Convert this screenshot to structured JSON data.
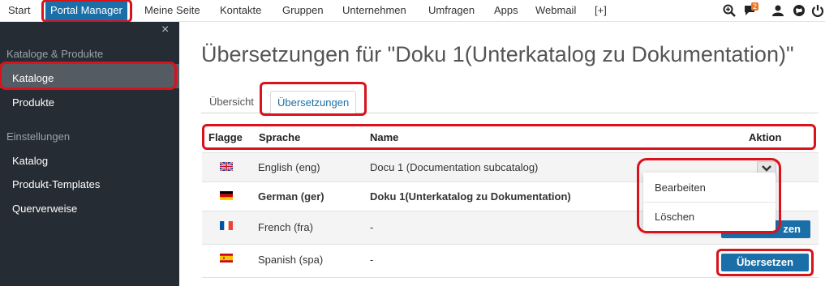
{
  "topnav": {
    "items": [
      "Start",
      "Portal Manager",
      "Meine Seite",
      "Kontakte",
      "Gruppen",
      "Unternehmen",
      "Umfragen",
      "Apps",
      "Webmail",
      "[+]"
    ],
    "notification_count": "2",
    "icons": [
      "zoom-icon",
      "chat-icon",
      "user-icon",
      "globe-icon",
      "power-icon"
    ]
  },
  "sidebar": {
    "close": "×",
    "sections": [
      "Kataloge & Produkte",
      "Einstellungen"
    ],
    "items": [
      "Kataloge",
      "Produkte",
      "Katalog",
      "Produkt-Templates",
      "Querverweise"
    ]
  },
  "main": {
    "title": "Übersetzungen für \"Doku 1(Unterkatalog zu Dokumentation)\"",
    "tabs": [
      "Übersicht",
      "Übersetzungen"
    ],
    "table": {
      "headers": [
        "Flagge",
        "Sprache",
        "Name",
        "Aktion"
      ],
      "rows": [
        {
          "language": "English (eng)",
          "name": "Docu 1 (Documentation subcatalog)",
          "flag": "gb-flag-icon"
        },
        {
          "language": "German (ger)",
          "name": "Doku 1(Unterkatalog zu Dokumentation)",
          "flag": "de-flag-icon"
        },
        {
          "language": "French (fra)",
          "name": "-",
          "flag": "fr-flag-icon"
        },
        {
          "language": "Spanish (spa)",
          "name": "-",
          "flag": "es-flag-icon"
        }
      ],
      "translate_label": "Übersetzen",
      "french_translate_visible": "zen"
    },
    "dropdown": {
      "items": [
        "Bearbeiten",
        "Löschen"
      ]
    }
  },
  "colors": {
    "accent": "#1b6fa8",
    "highlight": "#d9121c",
    "sidebar": "#262c33",
    "badge": "#f0731f"
  }
}
